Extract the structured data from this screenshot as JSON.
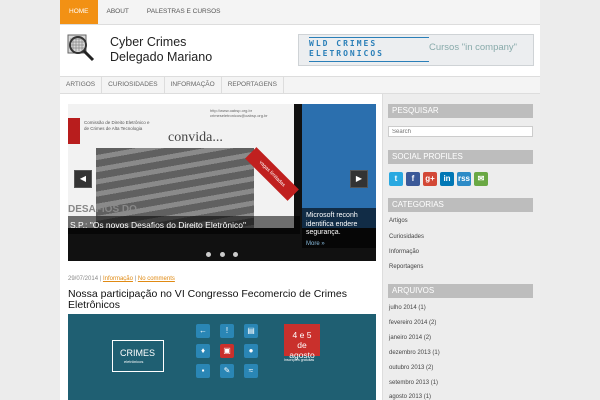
{
  "topnav": {
    "items": [
      "HOME",
      "ABOUT",
      "PALESTRAS E CURSOS"
    ]
  },
  "header": {
    "title_line1": "Cyber Crimes",
    "title_line2": "Delegado Mariano",
    "banner_main_top": "WLD CRIMES",
    "banner_main_bottom": "ELETRONICOS",
    "banner_tagline": "Cursos \"in company\""
  },
  "subnav": {
    "items": [
      "ARTIGOS",
      "CURIOSIDADES",
      "INFORMAÇÃO",
      "REPORTAGENS"
    ]
  },
  "slider": {
    "small_text": "Comissão de Direito Eletrônico e de Crimes de Alta Tecnologia",
    "url_text": "http://www.oabsp.org.br crimeseletronicos@oabsp.org.br",
    "convida": "convida...",
    "ribbon": "vagas limitadas",
    "ghost_text": "DESAFIOS DO",
    "caption": "S.P.: \"Os novos Desafios do Direito Eletrônico\"",
    "slide2_title": "Microsoft reconh identifica endere segurança.",
    "slide2_more": "More »",
    "prev_icon": "◀",
    "next_icon": "▶"
  },
  "post": {
    "date": "29/07/2014",
    "category": "Informação",
    "comments": "No comments",
    "title": "Nossa participação no VI Congresso Fecomercio de Crimes Eletrônicos",
    "image": {
      "crimes_label": "CRIMES",
      "crimes_sub": "eletrônicos",
      "date_day": "4 e 5",
      "date_month": "de agosto",
      "info": "Inscrições gratuitas"
    }
  },
  "sidebar": {
    "search_title": "PESQUISAR",
    "search_placeholder": "Search",
    "social_title": "SOCIAL PROFILES",
    "social": [
      {
        "label": "t",
        "color": "#29a9e1"
      },
      {
        "label": "f",
        "color": "#3b5998"
      },
      {
        "label": "g+",
        "color": "#d34836"
      },
      {
        "label": "in",
        "color": "#0077b5"
      },
      {
        "label": "rss",
        "color": "#2d8bc7"
      },
      {
        "label": "✉",
        "color": "#6aa844"
      }
    ],
    "categories_title": "CATEGORIAS",
    "categories": [
      "Artigos",
      "Curiosidades",
      "Informação",
      "Reportagens"
    ],
    "archives_title": "ARQUIVOS",
    "archives": [
      "julho 2014 (1)",
      "fevereiro 2014 (2)",
      "janeiro 2014 (2)",
      "dezembro 2013 (1)",
      "outubro 2013 (2)",
      "setembro 2013 (1)",
      "agosto 2013 (1)"
    ]
  },
  "colors": {
    "accent": "#f29114",
    "link": "#e08a13"
  }
}
